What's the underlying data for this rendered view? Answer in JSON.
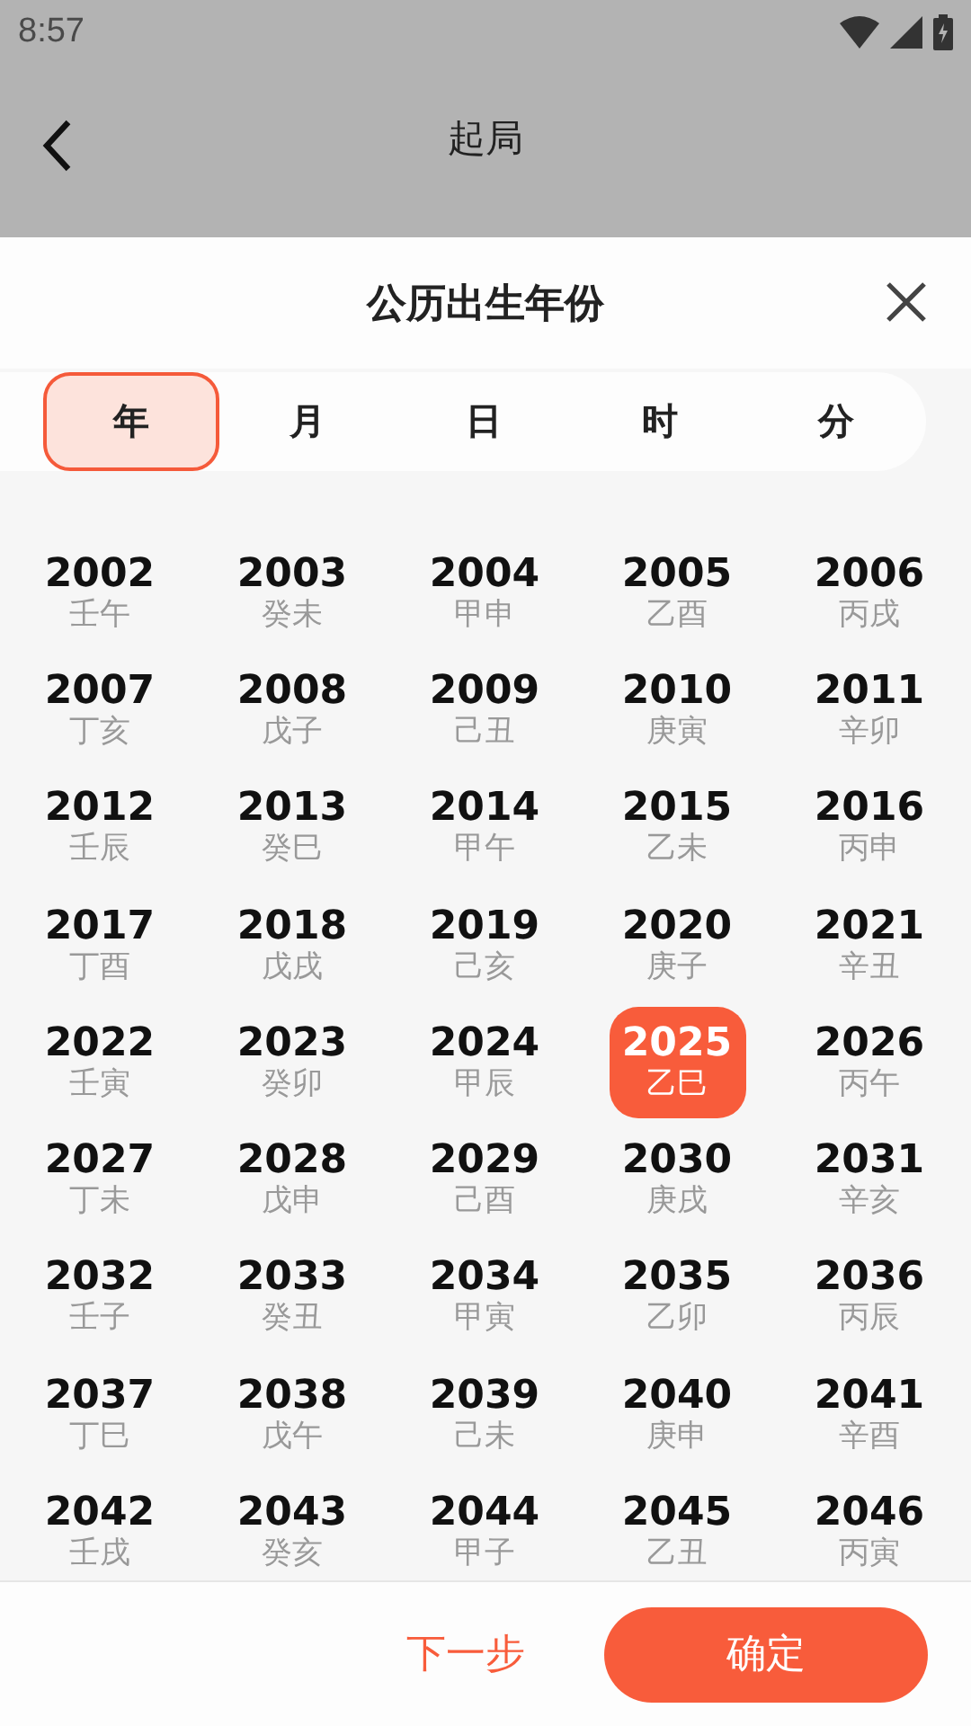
{
  "status_bar": {
    "time": "8:57"
  },
  "app_bar": {
    "title": "起局"
  },
  "sheet": {
    "title": "公历出生年份"
  },
  "tabs": [
    {
      "label": "年",
      "selected": true
    },
    {
      "label": "月",
      "selected": false
    },
    {
      "label": "日",
      "selected": false
    },
    {
      "label": "时",
      "selected": false
    },
    {
      "label": "分",
      "selected": false
    }
  ],
  "years": [
    {
      "year": "2002",
      "ganzhi": "壬午",
      "selected": false
    },
    {
      "year": "2003",
      "ganzhi": "癸未",
      "selected": false
    },
    {
      "year": "2004",
      "ganzhi": "甲申",
      "selected": false
    },
    {
      "year": "2005",
      "ganzhi": "乙酉",
      "selected": false
    },
    {
      "year": "2006",
      "ganzhi": "丙戌",
      "selected": false
    },
    {
      "year": "2007",
      "ganzhi": "丁亥",
      "selected": false
    },
    {
      "year": "2008",
      "ganzhi": "戊子",
      "selected": false
    },
    {
      "year": "2009",
      "ganzhi": "己丑",
      "selected": false
    },
    {
      "year": "2010",
      "ganzhi": "庚寅",
      "selected": false
    },
    {
      "year": "2011",
      "ganzhi": "辛卯",
      "selected": false
    },
    {
      "year": "2012",
      "ganzhi": "壬辰",
      "selected": false
    },
    {
      "year": "2013",
      "ganzhi": "癸巳",
      "selected": false
    },
    {
      "year": "2014",
      "ganzhi": "甲午",
      "selected": false
    },
    {
      "year": "2015",
      "ganzhi": "乙未",
      "selected": false
    },
    {
      "year": "2016",
      "ganzhi": "丙申",
      "selected": false
    },
    {
      "year": "2017",
      "ganzhi": "丁酉",
      "selected": false
    },
    {
      "year": "2018",
      "ganzhi": "戊戌",
      "selected": false
    },
    {
      "year": "2019",
      "ganzhi": "己亥",
      "selected": false
    },
    {
      "year": "2020",
      "ganzhi": "庚子",
      "selected": false
    },
    {
      "year": "2021",
      "ganzhi": "辛丑",
      "selected": false
    },
    {
      "year": "2022",
      "ganzhi": "壬寅",
      "selected": false
    },
    {
      "year": "2023",
      "ganzhi": "癸卯",
      "selected": false
    },
    {
      "year": "2024",
      "ganzhi": "甲辰",
      "selected": false
    },
    {
      "year": "2025",
      "ganzhi": "乙巳",
      "selected": true
    },
    {
      "year": "2026",
      "ganzhi": "丙午",
      "selected": false
    },
    {
      "year": "2027",
      "ganzhi": "丁未",
      "selected": false
    },
    {
      "year": "2028",
      "ganzhi": "戊申",
      "selected": false
    },
    {
      "year": "2029",
      "ganzhi": "己酉",
      "selected": false
    },
    {
      "year": "2030",
      "ganzhi": "庚戌",
      "selected": false
    },
    {
      "year": "2031",
      "ganzhi": "辛亥",
      "selected": false
    },
    {
      "year": "2032",
      "ganzhi": "壬子",
      "selected": false
    },
    {
      "year": "2033",
      "ganzhi": "癸丑",
      "selected": false
    },
    {
      "year": "2034",
      "ganzhi": "甲寅",
      "selected": false
    },
    {
      "year": "2035",
      "ganzhi": "乙卯",
      "selected": false
    },
    {
      "year": "2036",
      "ganzhi": "丙辰",
      "selected": false
    },
    {
      "year": "2037",
      "ganzhi": "丁巳",
      "selected": false
    },
    {
      "year": "2038",
      "ganzhi": "戊午",
      "selected": false
    },
    {
      "year": "2039",
      "ganzhi": "己未",
      "selected": false
    },
    {
      "year": "2040",
      "ganzhi": "庚申",
      "selected": false
    },
    {
      "year": "2041",
      "ganzhi": "辛酉",
      "selected": false
    },
    {
      "year": "2042",
      "ganzhi": "壬戌",
      "selected": false
    },
    {
      "year": "2043",
      "ganzhi": "癸亥",
      "selected": false
    },
    {
      "year": "2044",
      "ganzhi": "甲子",
      "selected": false
    },
    {
      "year": "2045",
      "ganzhi": "乙丑",
      "selected": false
    },
    {
      "year": "2046",
      "ganzhi": "丙寅",
      "selected": false
    }
  ],
  "footer": {
    "next_label": "下一步",
    "confirm_label": "确定"
  }
}
